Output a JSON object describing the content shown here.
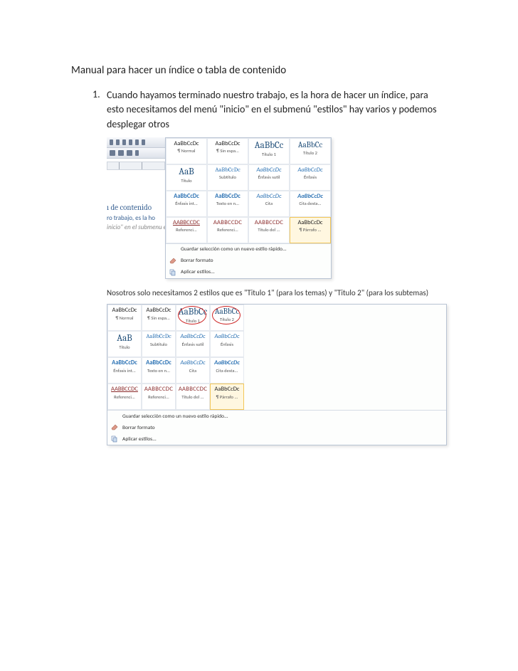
{
  "title": "Manual para hacer un índice o tabla de contenido",
  "step_number": "1.",
  "step_text": "Cuando hayamos terminado nuestro trabajo, es la hora de hacer un índice, para esto necesitamos del menú \"inicio\" en el submenú \"estilos\" hay varios y podemos desplegar otros",
  "note_text": "Nosotros solo necesitamos 2 estilos que es \"Titulo 1\" (para los temas) y \"Titulo 2\" (para los subtemas)",
  "styles": {
    "rows": [
      [
        {
          "sample": "AaBbCcDc",
          "cls": "",
          "label": "¶ Normal"
        },
        {
          "sample": "AaBbCcDc",
          "cls": "",
          "label": "¶ Sin espa..."
        },
        {
          "sample": "AaBbCc",
          "cls": "big",
          "label": "Título 1"
        },
        {
          "sample": "AaBbCc",
          "cls": "big2",
          "label": "Título 2"
        }
      ],
      [
        {
          "sample": "AaB",
          "cls": "big",
          "label": "Título"
        },
        {
          "sample": "AaBbCcDc",
          "cls": "blue",
          "label": "Subtítulo"
        },
        {
          "sample": "AaBbCcDc",
          "cls": "ital",
          "label": "Énfasis sutil"
        },
        {
          "sample": "AaBbCcDc",
          "cls": "ital",
          "label": "Énfasis"
        }
      ],
      [
        {
          "sample": "AaBbCcDc",
          "cls": "bold",
          "label": "Énfasis int..."
        },
        {
          "sample": "AaBbCcDc",
          "cls": "bold",
          "label": "Texto en n..."
        },
        {
          "sample": "AaBbCcDc",
          "cls": "ital",
          "label": "Cita"
        },
        {
          "sample": "AaBbCcDc",
          "cls": "bold ital",
          "label": "Cita desta..."
        }
      ],
      [
        {
          "sample": "AABBCCDC",
          "cls": "darkredu",
          "label": "Referenci..."
        },
        {
          "sample": "AABBCCDC",
          "cls": "darkred",
          "label": "Referenci..."
        },
        {
          "sample": "AABBCCDC",
          "cls": "darkred",
          "label": "Título del ..."
        },
        {
          "sample": "AaBbCcDc",
          "cls": "",
          "label": "¶ Párrafo ...",
          "selected": true
        }
      ]
    ],
    "menu": {
      "save": "Guardar selección como un nuevo estilo rápido...",
      "clear": "Borrar formato",
      "apply": "Aplicar estilos..."
    }
  },
  "doc_behind": {
    "heading": "ı de contenido",
    "line1": "ro trabajo, es la ho",
    "line2": "inicio\" en el submenu  estılos  nay varıos"
  },
  "circled": [
    2,
    3
  ]
}
